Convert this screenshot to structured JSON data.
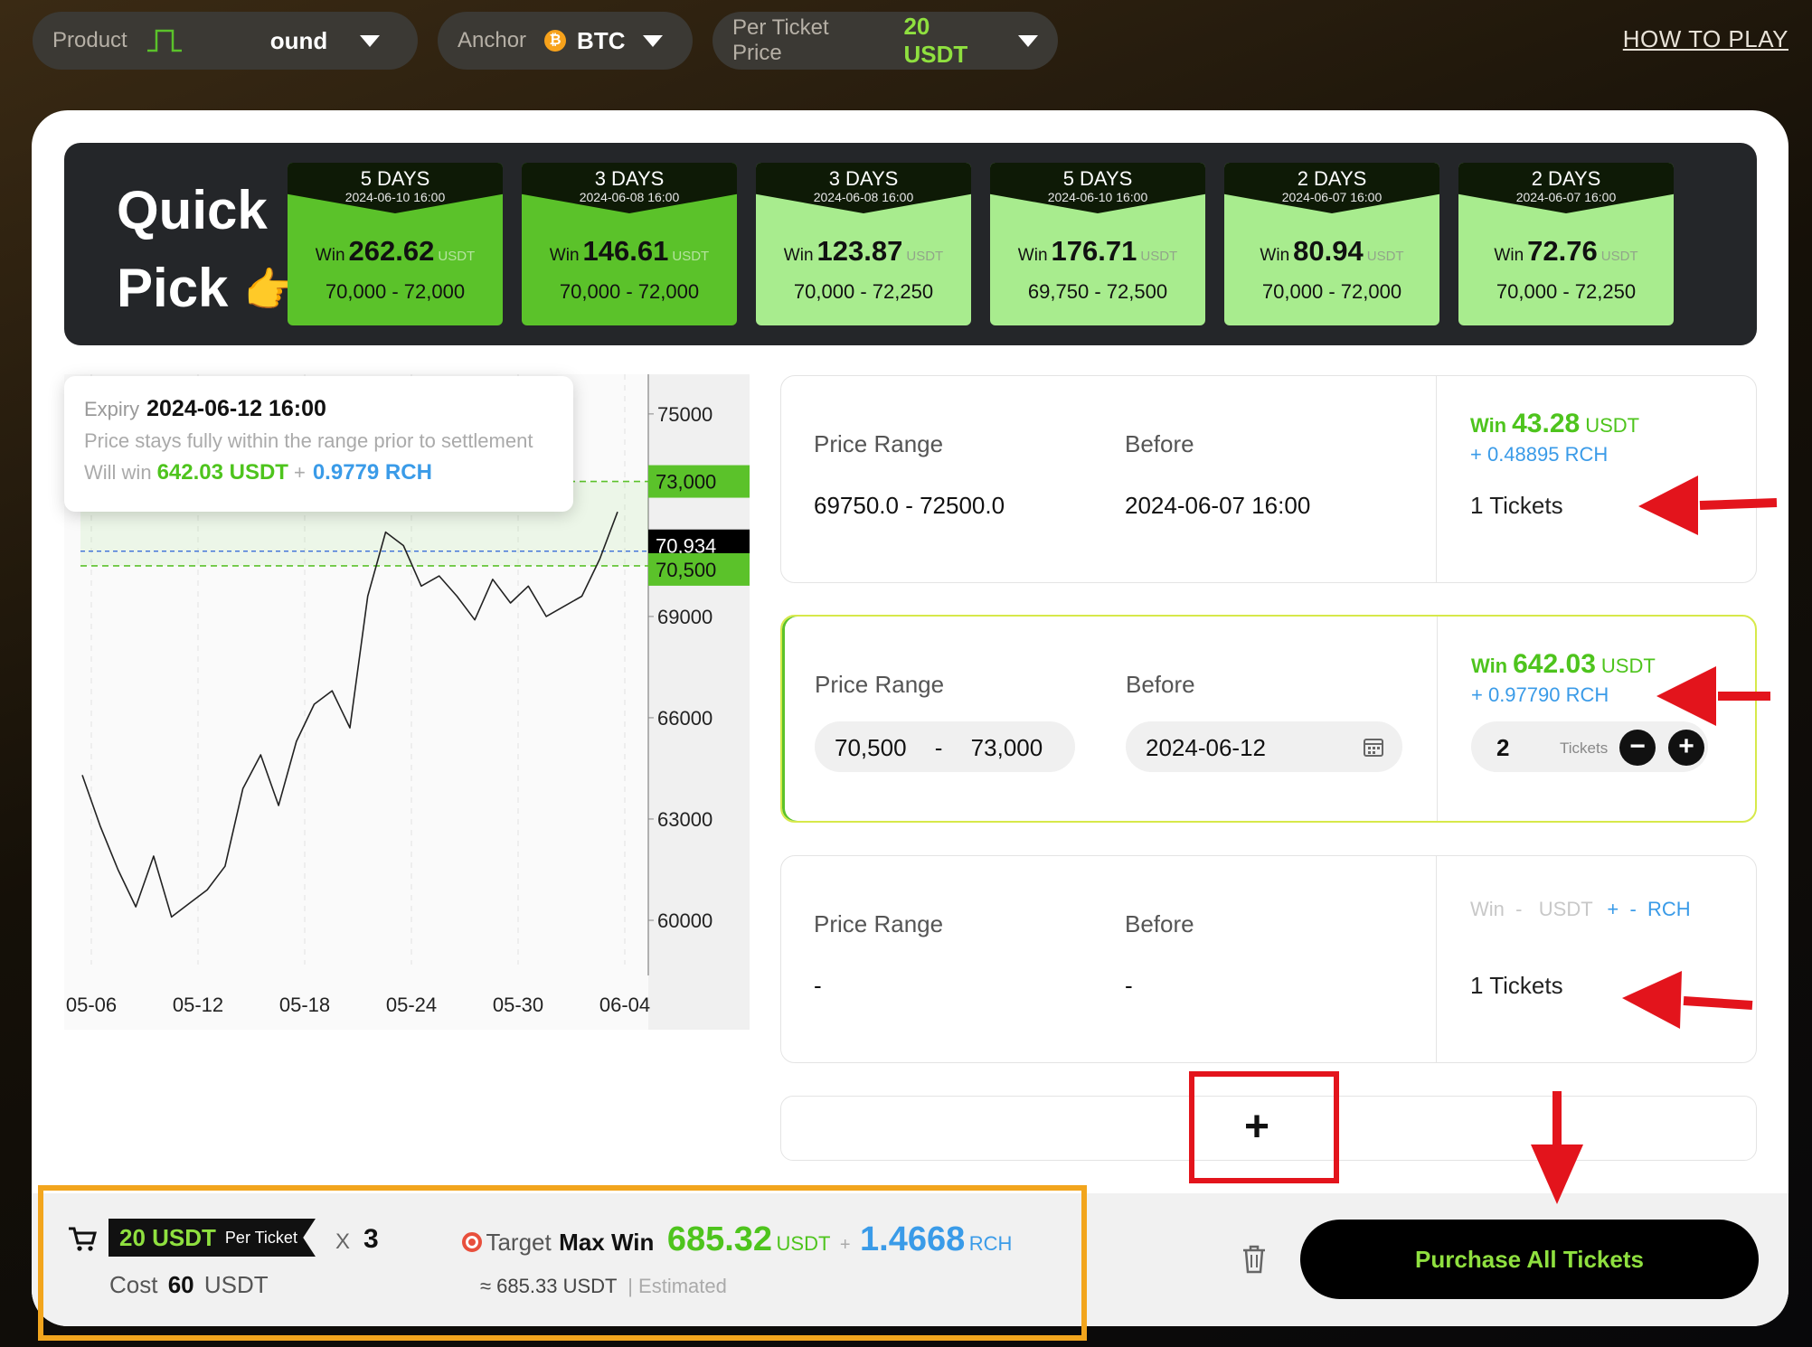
{
  "topbar": {
    "product_label": "Product",
    "product_value": "ound",
    "anchor_label": "Anchor",
    "anchor_value": "BTC",
    "price_label": "Per Ticket Price",
    "price_value": "20 USDT",
    "how_to_play": "HOW TO PLAY"
  },
  "quick_pick": {
    "title_line1": "Quick",
    "title_line2": "Pick",
    "hand_emoji": "👉",
    "win_label": "Win",
    "unit": "USDT",
    "cards": [
      {
        "days": "5 DAYS",
        "date": "2024-06-10 16:00",
        "win": "262.62",
        "range": "70,000 - 72,000",
        "style": "dark"
      },
      {
        "days": "3 DAYS",
        "date": "2024-06-08 16:00",
        "win": "146.61",
        "range": "70,000 - 72,000",
        "style": "dark"
      },
      {
        "days": "3 DAYS",
        "date": "2024-06-08 16:00",
        "win": "123.87",
        "range": "70,000 - 72,250",
        "style": "light"
      },
      {
        "days": "5 DAYS",
        "date": "2024-06-10 16:00",
        "win": "176.71",
        "range": "69,750 - 72,500",
        "style": "light"
      },
      {
        "days": "2 DAYS",
        "date": "2024-06-07 16:00",
        "win": "80.94",
        "range": "70,000 - 72,000",
        "style": "light"
      },
      {
        "days": "2 DAYS",
        "date": "2024-06-07 16:00",
        "win": "72.76",
        "range": "70,000 - 72,250",
        "style": "light"
      }
    ]
  },
  "tooltip": {
    "expiry_label": "Expiry",
    "expiry_value": "2024-06-12 16:00",
    "rule": "Price stays fully within the range prior to settlement",
    "will_win_label": "Will win",
    "will_win_usdt": "642.03 USDT",
    "plus": "+",
    "will_win_rch": "0.9779 RCH"
  },
  "chart_data": {
    "type": "line",
    "x_ticks": [
      "05-06",
      "05-12",
      "05-18",
      "05-24",
      "05-30",
      "06-04"
    ],
    "y_ticks": [
      75000,
      69000,
      66000,
      63000,
      60000
    ],
    "ylim": [
      58500,
      75800
    ],
    "range_upper_label": "73,000",
    "range_lower_label": "70,500",
    "current_price_label": "70,934",
    "range_upper": 73000,
    "range_lower": 70500,
    "current_price": 70934,
    "series": [
      {
        "x": [
          0,
          1,
          2,
          3,
          4,
          5,
          6,
          7,
          8,
          9,
          10,
          11,
          12,
          13,
          14,
          15,
          16,
          17,
          18,
          19,
          20,
          21,
          22,
          23,
          24,
          25,
          26,
          27,
          28,
          29,
          30
        ],
        "values": [
          64300,
          62800,
          61500,
          60400,
          61900,
          60100,
          60500,
          60900,
          61600,
          63900,
          64900,
          63400,
          65300,
          66400,
          66800,
          65700,
          69600,
          71500,
          71100,
          69900,
          70200,
          69600,
          68900,
          70100,
          69400,
          69900,
          69000,
          69300,
          69600,
          70700,
          72100
        ]
      }
    ]
  },
  "rows": [
    {
      "price_range_label": "Price Range",
      "before_label": "Before",
      "price_range_value": "69750.0 - 72500.0",
      "before_value": "2024-06-07 16:00",
      "win_label": "Win",
      "win_value": "43.28",
      "win_unit": "USDT",
      "rch_text": "+ 0.48895  RCH",
      "tickets": "1 Tickets"
    },
    {
      "price_range_label": "Price Range",
      "before_label": "Before",
      "range_low": "70,500",
      "range_sep": "-",
      "range_high": "73,000",
      "date": "2024-06-12",
      "win_label": "Win",
      "win_value": "642.03",
      "win_unit": "USDT",
      "rch_text": "+ 0.97790  RCH",
      "ticket_count": "2",
      "tickets_label": "Tickets"
    },
    {
      "price_range_label": "Price Range",
      "before_label": "Before",
      "price_range_value": "-",
      "before_value": "-",
      "win_text": "Win  -   USDT",
      "rch_text": "+  -  RCH",
      "tickets": "1 Tickets"
    }
  ],
  "add_button": "+",
  "footer": {
    "per_ticket_value": "20 USDT",
    "per_ticket_label": "Per Ticket",
    "times": "X",
    "count": "3",
    "cost_label": "Cost",
    "cost_value": "60",
    "cost_unit": "USDT",
    "target_label": "Target",
    "max_win_label": "Max Win",
    "max_win_usdt": "685.32",
    "usdt_unit": "USDT",
    "plus": "+",
    "max_win_rch": "1.4668",
    "rch_unit": "RCH",
    "approx_value": "≈ 685.33",
    "approx_unit": "USDT",
    "estimated": "| Estimated",
    "purchase_button": "Purchase All Tickets"
  },
  "colors": {
    "accent_green": "#4ec41d",
    "rch_blue": "#3a9be8",
    "annotation_red": "#e3141c",
    "annotation_orange": "#f2a51d"
  }
}
